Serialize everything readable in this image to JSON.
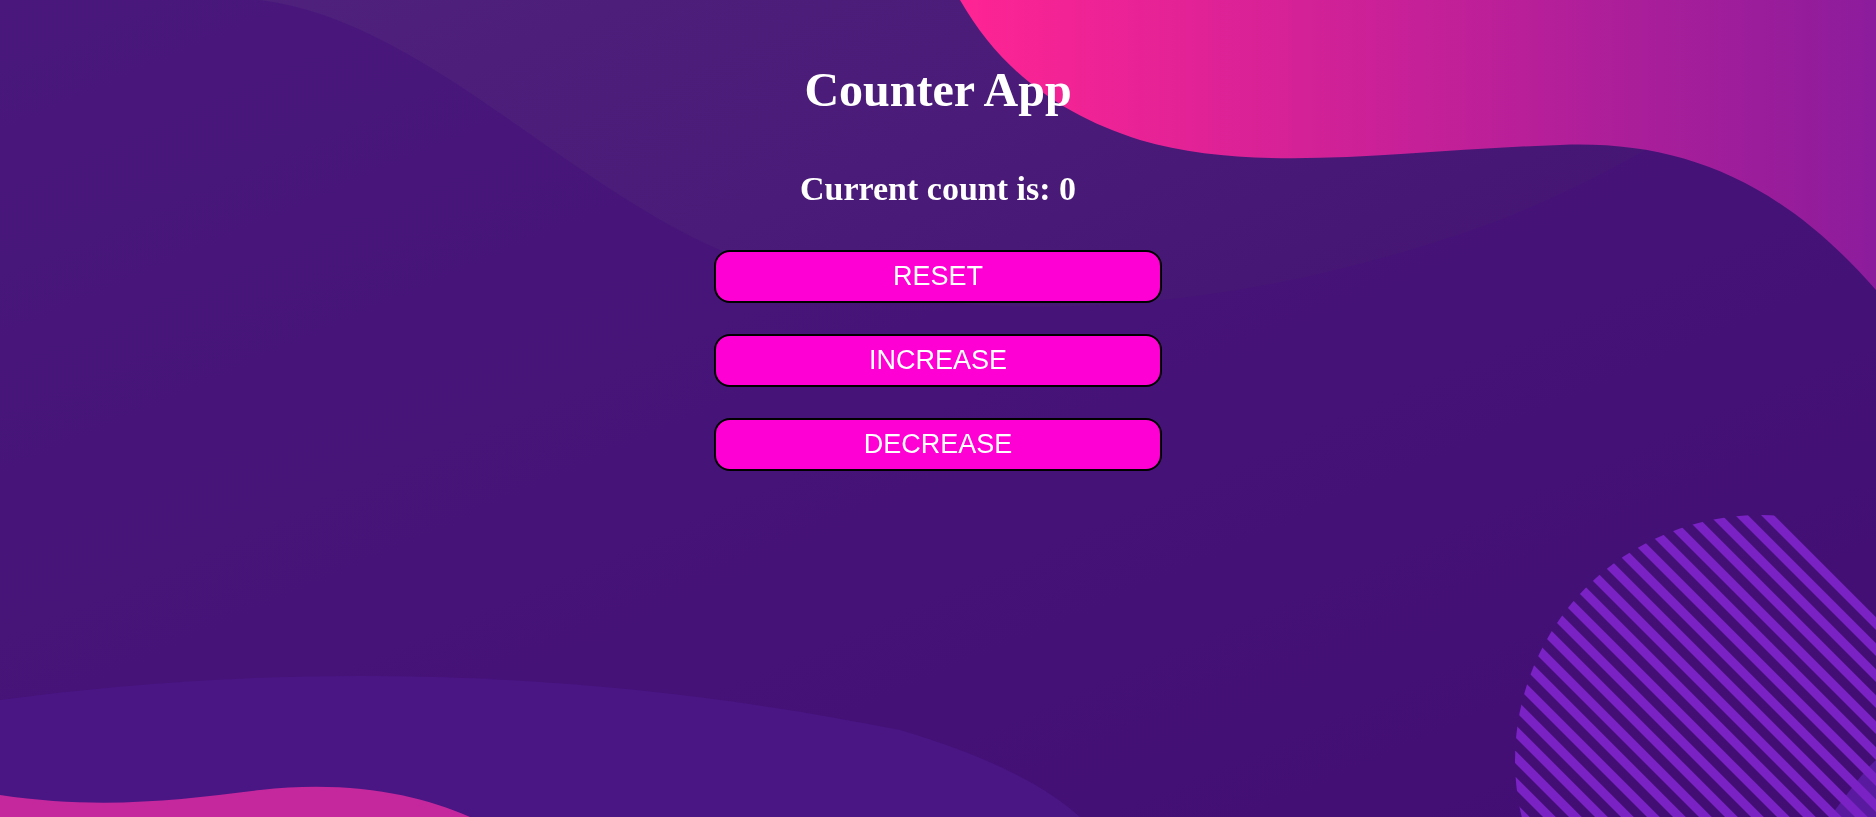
{
  "title": "Counter App",
  "count_text": "Current count is: 0",
  "buttons": [
    {
      "label": "RESET"
    },
    {
      "label": "INCREASE"
    },
    {
      "label": "DECREASE"
    }
  ]
}
